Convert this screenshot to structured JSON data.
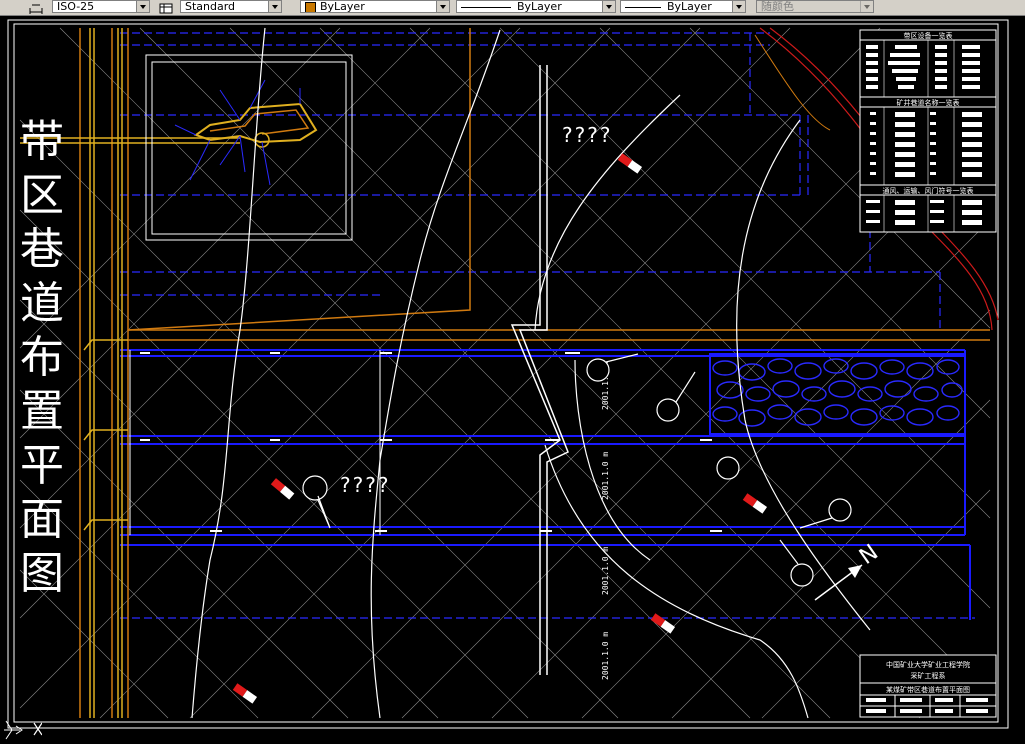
{
  "toolbar": {
    "dimstyle_value": "ISO-25",
    "tablestyle_value": "Standard",
    "layer_color_value": "ByLayer",
    "linetype_value": "ByLayer",
    "lineweight_value": "ByLayer",
    "plotstyle_value": "随颜色"
  },
  "drawing": {
    "title_vertical": [
      "带",
      "区",
      "巷",
      "道",
      "布",
      "置",
      "平",
      "面",
      "图"
    ],
    "unknown_label_1": "????",
    "unknown_label_2": "????",
    "north_label": "N",
    "dim_labels": [
      "2001.1.0 m",
      "2001.1.0 m",
      "2001.1.0 m",
      "2001.1.0 m"
    ],
    "legend_title_1": "带区设备一览表",
    "legend_title_2": "矿井巷道名称一览表",
    "legend_title_3": "通风、运输、风门符号一览表",
    "titleblock_line1": "中国矿业大学矿业工程学院",
    "titleblock_line2": "采矿工程系",
    "titleblock_drawing": "某煤矿带区巷道布置平面图"
  },
  "colors": {
    "background": "#000000",
    "roadway_blue": "#1a1aff",
    "dashed_blue": "#2a2aff",
    "orange": "#d07a10",
    "yellow": "#e0b020",
    "red_boundary": "#cc1a1a",
    "grid": "#8a8a8a",
    "white": "#ffffff"
  }
}
